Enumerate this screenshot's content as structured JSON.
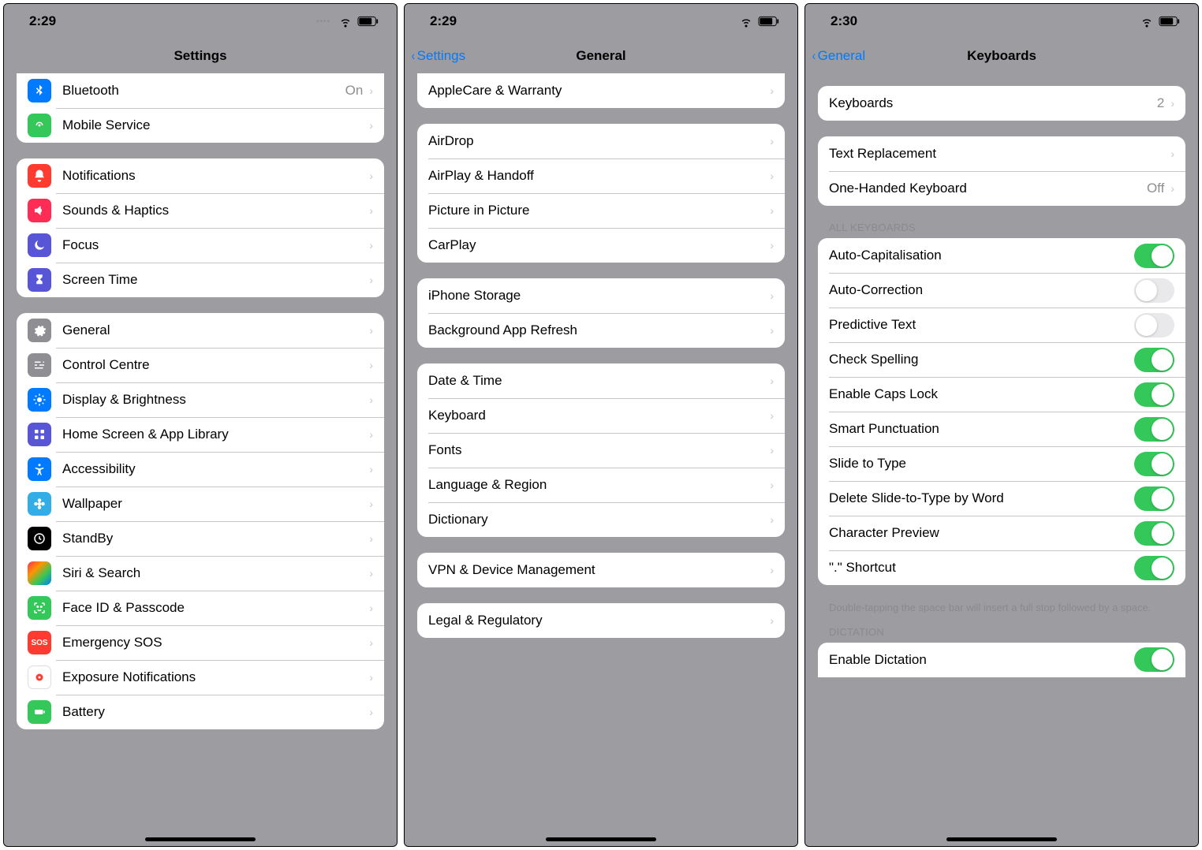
{
  "screen1": {
    "time": "2:29",
    "title": "Settings",
    "group_top": {
      "bluetooth": {
        "label": "Bluetooth",
        "value": "On"
      },
      "mobile": {
        "label": "Mobile Service"
      }
    },
    "group_notif": {
      "notifications": {
        "label": "Notifications"
      },
      "sounds": {
        "label": "Sounds & Haptics"
      },
      "focus": {
        "label": "Focus"
      },
      "screentime": {
        "label": "Screen Time"
      }
    },
    "group_gen": {
      "general": {
        "label": "General"
      },
      "control": {
        "label": "Control Centre"
      },
      "display": {
        "label": "Display & Brightness"
      },
      "home": {
        "label": "Home Screen & App Library"
      },
      "accessibility": {
        "label": "Accessibility"
      },
      "wallpaper": {
        "label": "Wallpaper"
      },
      "standby": {
        "label": "StandBy"
      },
      "siri": {
        "label": "Siri & Search"
      },
      "faceid": {
        "label": "Face ID & Passcode"
      },
      "sos": {
        "label": "Emergency SOS"
      },
      "exposure": {
        "label": "Exposure Notifications"
      },
      "battery": {
        "label": "Battery"
      }
    }
  },
  "screen2": {
    "time": "2:29",
    "back": "Settings",
    "title": "General",
    "row_applecare": "AppleCare & Warranty",
    "rows_air": {
      "airdrop": "AirDrop",
      "airplay": "AirPlay & Handoff",
      "pip": "Picture in Picture",
      "carplay": "CarPlay"
    },
    "rows_storage": {
      "storage": "iPhone Storage",
      "refresh": "Background App Refresh"
    },
    "rows_date": {
      "date": "Date & Time",
      "keyboard": "Keyboard",
      "fonts": "Fonts",
      "language": "Language & Region",
      "dictionary": "Dictionary"
    },
    "row_vpn": "VPN & Device Management",
    "row_legal": "Legal & Regulatory"
  },
  "screen3": {
    "time": "2:30",
    "back": "General",
    "title": "Keyboards",
    "row_keyboards": {
      "label": "Keyboards",
      "value": "2"
    },
    "rows_text": {
      "replacement": {
        "label": "Text Replacement"
      },
      "onehand": {
        "label": "One-Handed Keyboard",
        "value": "Off"
      }
    },
    "section_all": "All Keyboards",
    "toggles": {
      "autocap": {
        "label": "Auto-Capitalisation",
        "on": true
      },
      "autocorrect": {
        "label": "Auto-Correction",
        "on": false
      },
      "predictive": {
        "label": "Predictive Text",
        "on": false
      },
      "spell": {
        "label": "Check Spelling",
        "on": true
      },
      "caps": {
        "label": "Enable Caps Lock",
        "on": true
      },
      "smart": {
        "label": "Smart Punctuation",
        "on": true
      },
      "slide": {
        "label": "Slide to Type",
        "on": true
      },
      "delslide": {
        "label": "Delete Slide-to-Type by Word",
        "on": true
      },
      "preview": {
        "label": "Character Preview",
        "on": true
      },
      "shortcut": {
        "label": "\".\" Shortcut",
        "on": true
      }
    },
    "footer_shortcut": "Double-tapping the space bar will insert a full stop followed by a space.",
    "section_dict": "Dictation",
    "toggle_dict": {
      "label": "Enable Dictation",
      "on": true
    }
  }
}
